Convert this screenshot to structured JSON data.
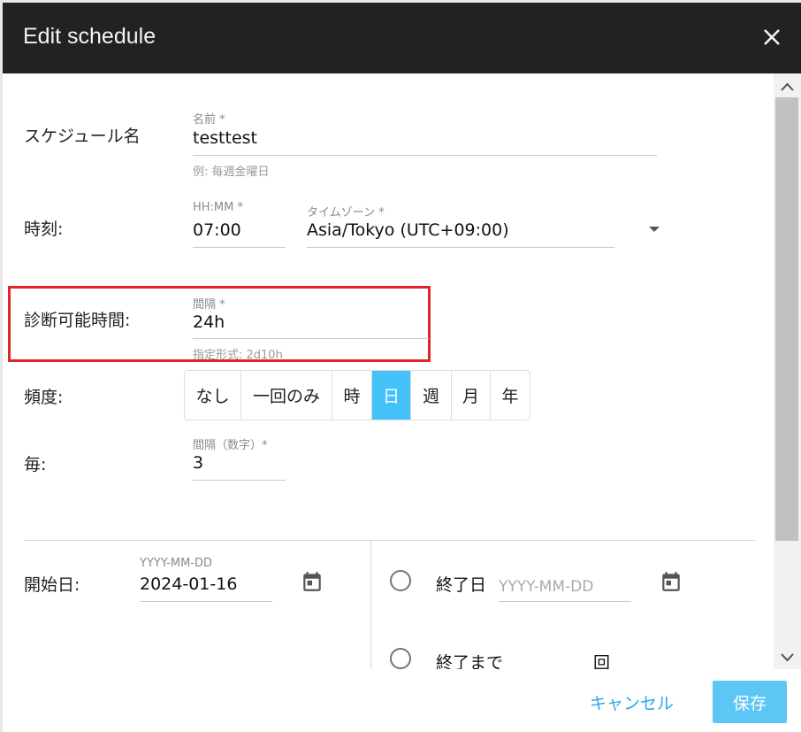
{
  "dialog": {
    "title": "Edit schedule"
  },
  "schedule_name": {
    "row_label": "スケジュール名",
    "field_label": "名前 *",
    "value": "testtest",
    "hint": "例: 毎週金曜日"
  },
  "time": {
    "row_label": "時刻:",
    "field_label": "HH:MM *",
    "value": "07:00",
    "timezone_label": "タイムゾーン *",
    "timezone_value": "Asia/Tokyo (UTC+09:00)"
  },
  "diagnosis": {
    "row_label": "診断可能時間:",
    "field_label": "間隔 *",
    "value": "24h",
    "hint": "指定形式: 2d10h"
  },
  "frequency": {
    "row_label": "頻度:",
    "options": [
      "なし",
      "一回のみ",
      "時",
      "日",
      "週",
      "月",
      "年"
    ],
    "selected": "日"
  },
  "every": {
    "row_label": "毎:",
    "field_label": "間隔（数字）*",
    "value": "3"
  },
  "start_date": {
    "row_label": "開始日:",
    "field_label": "YYYY-MM-DD",
    "value": "2024-01-16"
  },
  "end": {
    "end_date_label": "終了日",
    "end_date_placeholder": "YYYY-MM-DD",
    "until_label": "終了まで",
    "count_suffix": "回"
  },
  "footer": {
    "cancel_label": "キャンセル",
    "save_label": "保存"
  },
  "colors": {
    "title_bar": "#222222",
    "accent": "#42c2f8",
    "highlight_box": "#e0242b",
    "cancel_text": "#2aa8e6"
  }
}
